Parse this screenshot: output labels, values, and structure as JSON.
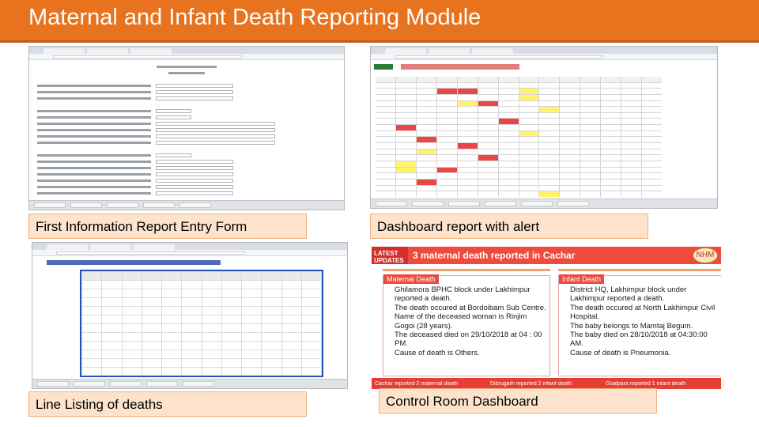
{
  "slide": {
    "title": "Maternal and Infant Death Reporting Module"
  },
  "captions": {
    "fir": "First Information Report Entry Form",
    "dashboard": "Dashboard report with alert",
    "line_listing": "Line Listing of deaths",
    "control_room": "Control Room Dashboard"
  },
  "control_room": {
    "latest_label": "LATEST UPDATES",
    "alert": "3 maternal death reported in Cachar",
    "logo": "NHM",
    "maternal": {
      "tag": "Maternal Death",
      "lines": [
        "Ghilamora BPHC block under Lakhimpur reported a death.",
        "The death occured at Bordoibam Sub Centre.",
        "Name of the deceased woman is Rinjim Gogoi (28 years).",
        "The deceased died on 29/10/2018 at 04 : 00 PM.",
        "Cause of death is Others."
      ]
    },
    "infant": {
      "tag": "Infant Death",
      "lines": [
        "District HQ, Lakhimpur block under Lakhimpur reported a death.",
        "The death occured at North Lakhimpur Civil Hospital.",
        "The baby belongs to Mamtaj Begum.",
        "The baby died on 28/10/2018 at 04:30:00 AM.",
        "Cause of death is Pneumonia."
      ]
    },
    "ticker": [
      "Cachar reported 2 maternal death",
      "Dibrugarh reported 2 infant death",
      "Goalpara reported 1 infant death"
    ]
  },
  "colors": {
    "title_bar": "#e8731f",
    "caption_bg": "#fde3cc",
    "alert_red": "#ef4a3c",
    "cell_yellow": "#fff36b",
    "cell_red": "#e64848"
  }
}
